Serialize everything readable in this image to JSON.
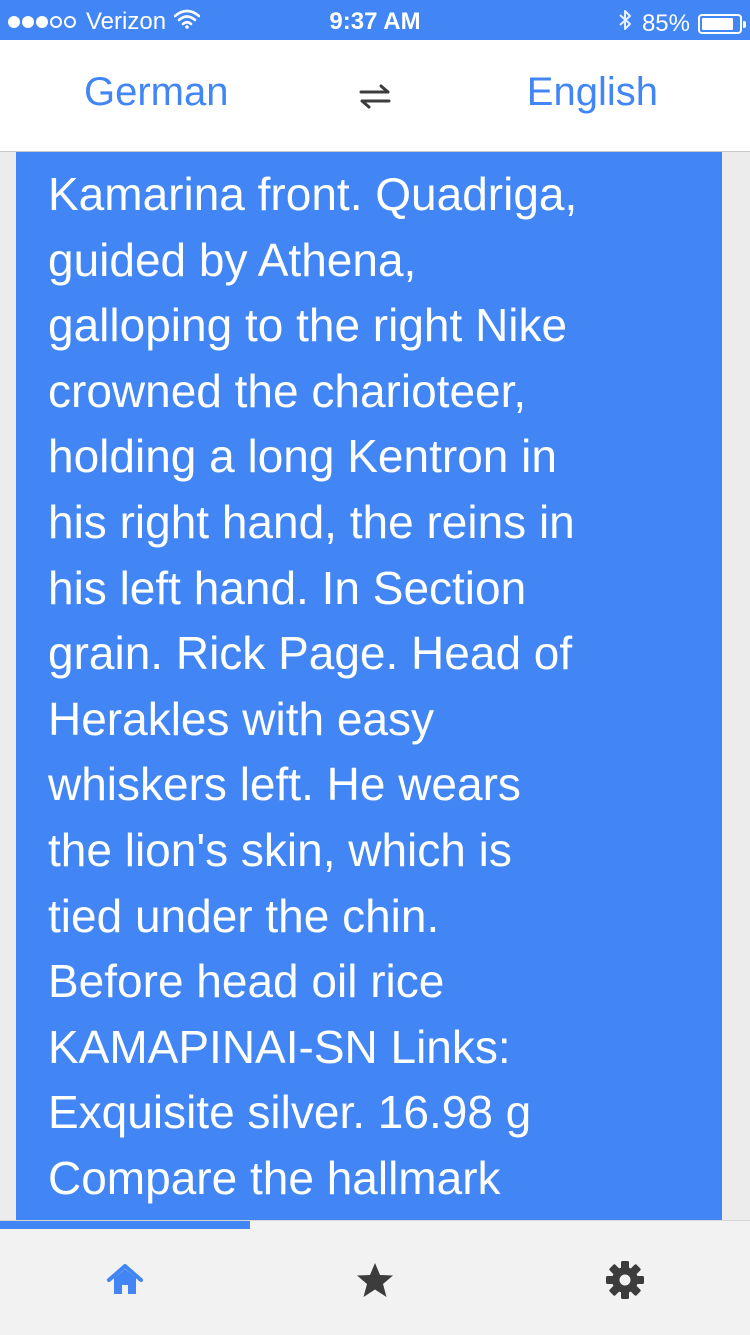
{
  "status_bar": {
    "carrier": "Verizon",
    "signal_bars_total": 5,
    "signal_bars_filled": 3,
    "time": "9:37 AM",
    "battery_percent": "85%",
    "battery_level": 0.85,
    "icons": [
      "wifi-icon",
      "bluetooth-icon",
      "battery-icon"
    ]
  },
  "language_bar": {
    "source_language": "German",
    "target_language": "English",
    "swap_icon": "swap-arrows-icon"
  },
  "translation": {
    "text": "Kamarina front. Quadriga,\nguided by Athena,\ngalloping to the right Nike\ncrowned the charioteer,\nholding a long Kentron in\nhis right hand, the reins in\nhis left hand. In Section\ngrain. Rick Page. Head of\nHerakles with easy\nwhiskers left. He wears\nthe lion's skin, which is\ntied under the chin.\nBefore head oil rice\nKAMAPINAI-SN Links:\nExquisite silver. 16.98 g\nCompare the hallmark"
  },
  "bottom_nav": {
    "active_tab": "home",
    "items": [
      {
        "id": "home",
        "icon": "home-icon"
      },
      {
        "id": "favorites",
        "icon": "star-icon"
      },
      {
        "id": "settings",
        "icon": "gear-icon"
      }
    ]
  },
  "colors": {
    "accent": "#4285f4",
    "text_on_accent": "#ffffff",
    "icon_inactive": "#3c3c3c",
    "background": "#ececec"
  }
}
